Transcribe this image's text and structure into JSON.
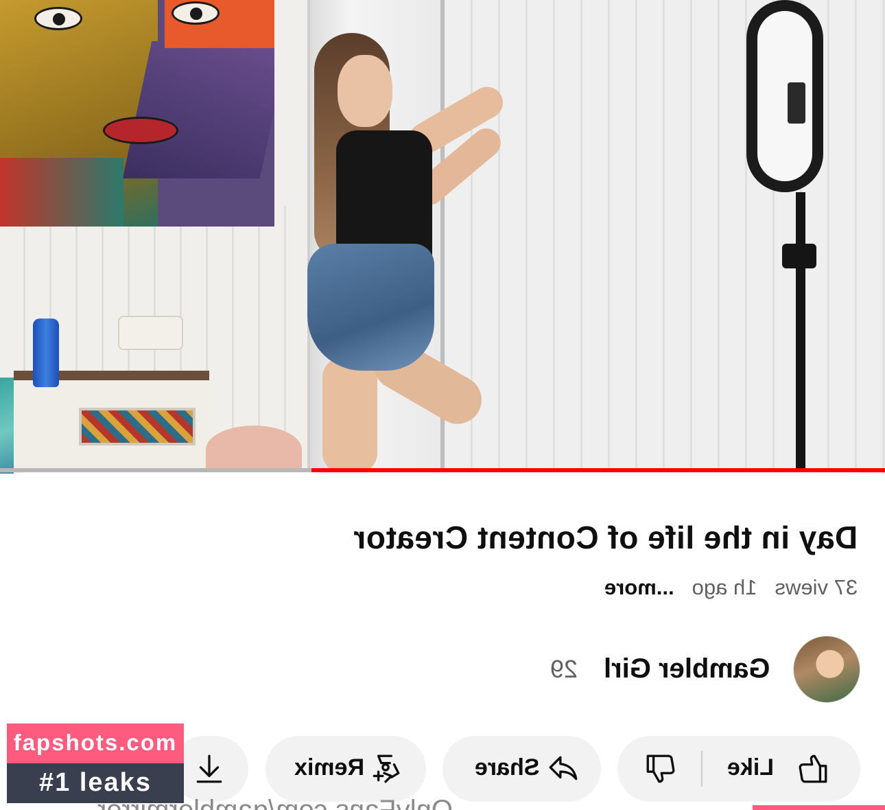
{
  "video": {
    "progress_fraction": 0.648,
    "progress_color": "#ff0000"
  },
  "details": {
    "title": "Day in the life of Content Creator",
    "views": "37 views",
    "age": "1h ago",
    "more_label": "...more"
  },
  "channel": {
    "name": "Gambler Girl",
    "subscribers": "29"
  },
  "actions": {
    "like_label": "Like",
    "share_label": "Share",
    "remix_label": "Remix"
  },
  "overlay_caption": "OnlyFans.com/gamblermirror",
  "watermark": {
    "site": "fapshots.com",
    "tagline": "#1 leaks",
    "color_pink": "#ff5b7f",
    "color_dark": "#3a3f4f"
  },
  "icons": [
    "like-icon",
    "dislike-icon",
    "share-icon",
    "remix-icon",
    "download-icon"
  ]
}
